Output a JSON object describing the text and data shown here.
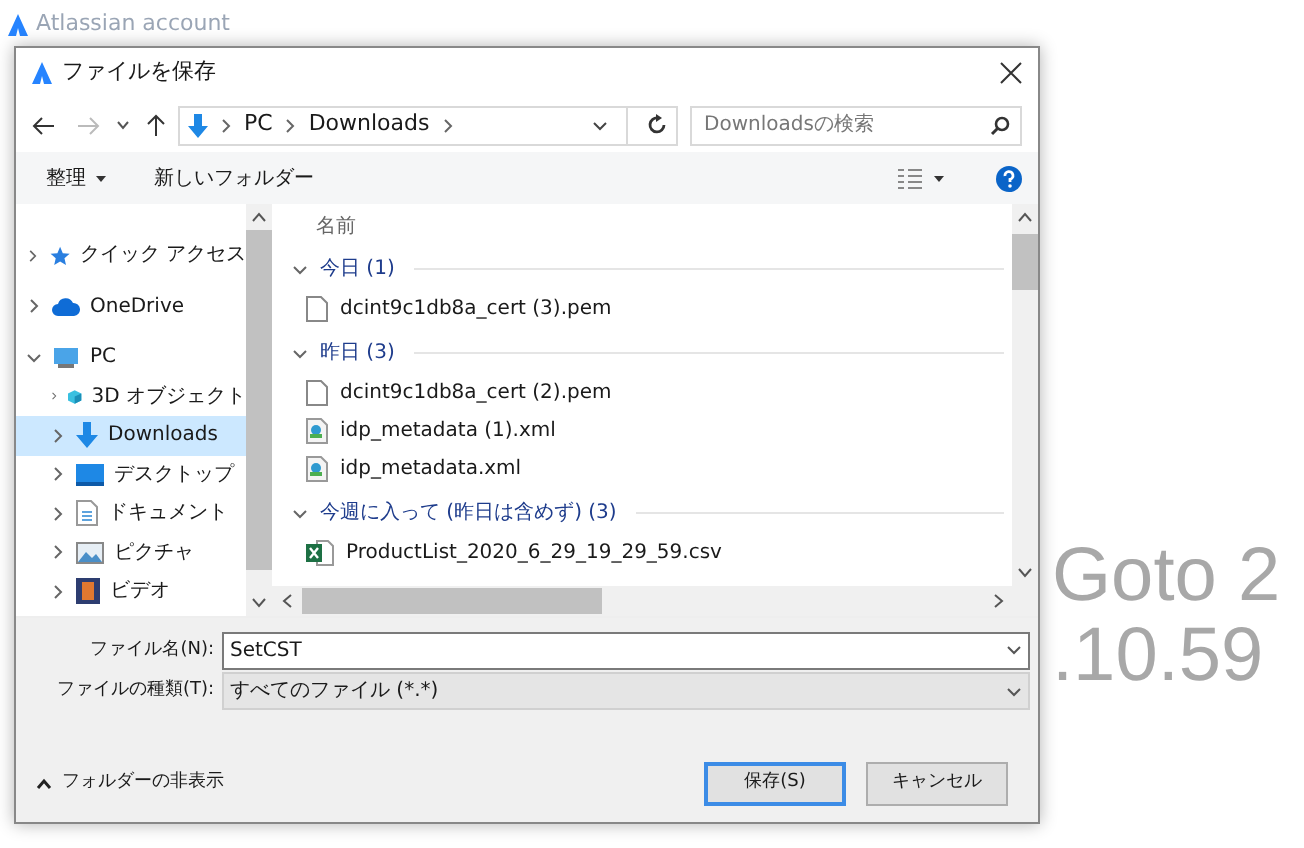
{
  "background_app": {
    "title": "Atlassian account",
    "big_text": [
      "Goto 2",
      ".10.59"
    ]
  },
  "dialog": {
    "title": "ファイルを保存",
    "address": [
      "PC",
      "Downloads"
    ],
    "search": {
      "placeholder": "Downloadsの検索"
    },
    "toolbar": {
      "organize": "整理",
      "new_folder": "新しいフォルダー"
    },
    "nav": [
      {
        "label": "クイック アクセス",
        "kind": "star",
        "expanded": false,
        "selected": false
      },
      {
        "label": "OneDrive",
        "kind": "cloud",
        "expanded": false,
        "selected": false
      },
      {
        "label": "PC",
        "kind": "pc",
        "expanded": true,
        "selected": false,
        "children": [
          {
            "label": "3D オブジェクト",
            "kind": "cube",
            "expanded": false,
            "selected": false
          },
          {
            "label": "Downloads",
            "kind": "download",
            "expanded": false,
            "selected": true
          },
          {
            "label": "デスクトップ",
            "kind": "desktop",
            "expanded": false,
            "selected": false
          },
          {
            "label": "ドキュメント",
            "kind": "document",
            "expanded": false,
            "selected": false
          },
          {
            "label": "ピクチャ",
            "kind": "pictures",
            "expanded": false,
            "selected": false
          },
          {
            "label": "ビデオ",
            "kind": "video",
            "expanded": false,
            "selected": false
          }
        ]
      }
    ],
    "column_header": "名前",
    "groups": [
      {
        "label": "今日 (1)",
        "expanded": true,
        "files": [
          {
            "name": "dcint9c1db8a_cert (3).pem",
            "kind": "blank"
          }
        ]
      },
      {
        "label": "昨日 (3)",
        "expanded": true,
        "files": [
          {
            "name": "dcint9c1db8a_cert (2).pem",
            "kind": "blank"
          },
          {
            "name": "idp_metadata (1).xml",
            "kind": "xml"
          },
          {
            "name": "idp_metadata.xml",
            "kind": "xml"
          }
        ]
      },
      {
        "label": "今週に入って (昨日は含めず) (3)",
        "expanded": true,
        "files": [
          {
            "name": "ProductList_2020_6_29_19_29_59.csv",
            "kind": "csv"
          }
        ]
      }
    ],
    "file_name": {
      "label": "ファイル名(N):",
      "value": "SetCST"
    },
    "file_type": {
      "label": "ファイルの種類(T):",
      "value": "すべてのファイル (*.*)"
    },
    "hide_folders": "フォルダーの非表示",
    "buttons": [
      {
        "label": "保存(S)",
        "default": true
      },
      {
        "label": "キャンセル",
        "default": false
      }
    ]
  }
}
